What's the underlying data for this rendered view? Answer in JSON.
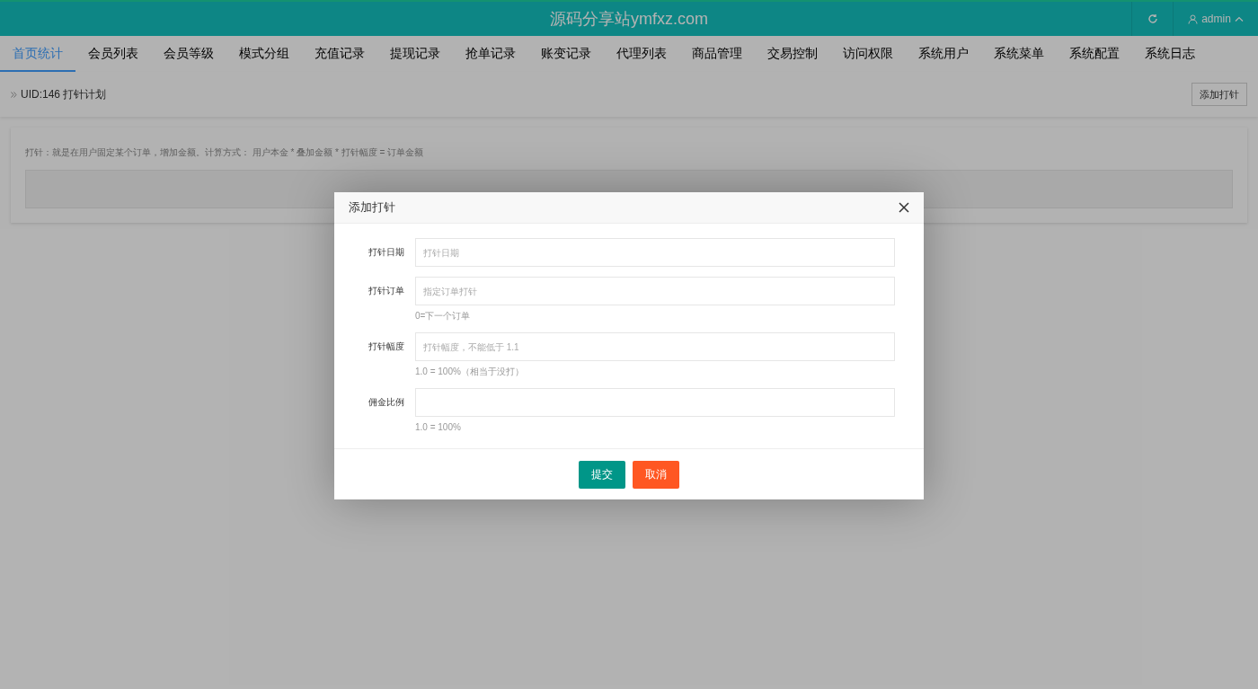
{
  "header": {
    "title": "源码分享站ymfxz.com",
    "user": "admin"
  },
  "tabs": [
    {
      "label": "首页统计",
      "selected": true
    },
    {
      "label": "会员列表",
      "selected": false
    },
    {
      "label": "会员等级",
      "selected": false
    },
    {
      "label": "模式分组",
      "selected": false
    },
    {
      "label": "充值记录",
      "selected": false
    },
    {
      "label": "提现记录",
      "selected": false
    },
    {
      "label": "抢单记录",
      "selected": false
    },
    {
      "label": "账变记录",
      "selected": false
    },
    {
      "label": "代理列表",
      "selected": false
    },
    {
      "label": "商品管理",
      "selected": false
    },
    {
      "label": "交易控制",
      "selected": false
    },
    {
      "label": "访问权限",
      "selected": false
    },
    {
      "label": "系统用户",
      "selected": false
    },
    {
      "label": "系统菜单",
      "selected": false
    },
    {
      "label": "系统配置",
      "selected": false
    },
    {
      "label": "系统日志",
      "selected": false
    }
  ],
  "breadcrumb": "UID:146 打针计划",
  "add_button": "添加打针",
  "note": "打针：就是在用户固定某个订单，增加金额。计算方式： 用户本金 * 叠加金额 * 打针幅度 = 订单金额",
  "dialog": {
    "title": "添加打针",
    "fields": [
      {
        "label": "打针日期",
        "placeholder": "打针日期"
      },
      {
        "label": "打针订单",
        "placeholder": "指定订单打针",
        "hint": "0=下一个订单"
      },
      {
        "label": "打针幅度",
        "placeholder": "打针幅度，不能低于 1.1",
        "hint": "1.0 = 100%（相当于没打）"
      },
      {
        "label": "佣金比例",
        "hint": "1.0 = 100%"
      }
    ],
    "buttons": [
      {
        "label": "提交",
        "kind": "primary"
      },
      {
        "label": "取消",
        "kind": "danger"
      }
    ]
  }
}
